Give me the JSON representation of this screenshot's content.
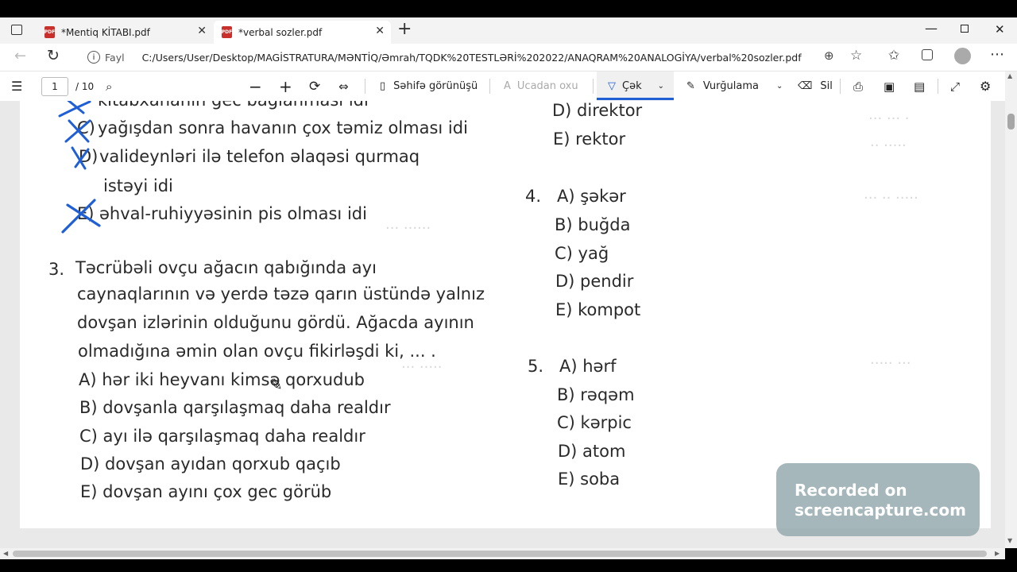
{
  "browser": {
    "tabs": [
      {
        "title": "*Mentiq KİTABI.pdf",
        "active": false
      },
      {
        "title": "*verbal sozler.pdf",
        "active": true
      }
    ],
    "address": {
      "label": "Fayl",
      "url": "C:/Users/User/Desktop/MAGİSTRATURA/MƏNTİQ/Əmrah/TQDK%20TESTLƏRİ%202022/ANAQRAM%20ANALOGİYA/verbal%20sozler.pdf"
    }
  },
  "pdf_toolbar": {
    "page_current": "1",
    "page_total": "/ 10",
    "page_view": "Səhifə görünüşü",
    "read_aloud": "Ucadan oxu",
    "draw": "Çək",
    "highlight": "Vurğulama",
    "erase": "Sil"
  },
  "document": {
    "left": {
      "q2_lines": [
        "kitabxananın gec bağlanması idi",
        "yağışdan sonra havanın çox təmiz olması idi",
        "valideynləri ilə telefon əlaqəsi qurmaq",
        "istəyi idi",
        "əhval-ruhiyyəsinin pis olması idi"
      ],
      "q2_letters": {
        "c": "C)",
        "d": "D)",
        "e": "E)"
      },
      "q3": {
        "number": "3.",
        "stem": [
          "Təcrübəli ovçu ağacın qabığında ayı",
          "caynaqlarının və yerdə təzə qarın üstündə yalnız",
          "dovşan izlərinin olduğunu gördü. Ağacda ayının",
          "olmadığına əmin olan ovçu fikirləşdi ki, ... ."
        ],
        "options": [
          "A) hər iki heyvanı kimsə qorxudub",
          "B) dovşanla qarşılaşmaq daha realdır",
          "C) ayı ilə qarşılaşmaq daha realdır",
          "D) dovşan ayıdan qorxub qaçıb",
          "E)  dovşan ayını çox gec görüb"
        ]
      }
    },
    "right": {
      "q3_tail": [
        "D) direktor",
        "E) rektor"
      ],
      "q4": {
        "number": "4.",
        "options": [
          "A) şəkər",
          "B) buğda",
          "C) yağ",
          "D) pendir",
          "E) kompot"
        ]
      },
      "q5": {
        "number": "5.",
        "options": [
          "A) hərf",
          "B) rəqəm",
          "C) kərpic",
          "D) atom",
          "E) soba"
        ]
      }
    }
  },
  "watermark": {
    "line1": "Recorded on",
    "line2": "screencapture.com"
  },
  "colors": {
    "ink": "#1f5fd6",
    "active_tab": "#ffffff",
    "draw_underline": "#1f5fd6"
  }
}
